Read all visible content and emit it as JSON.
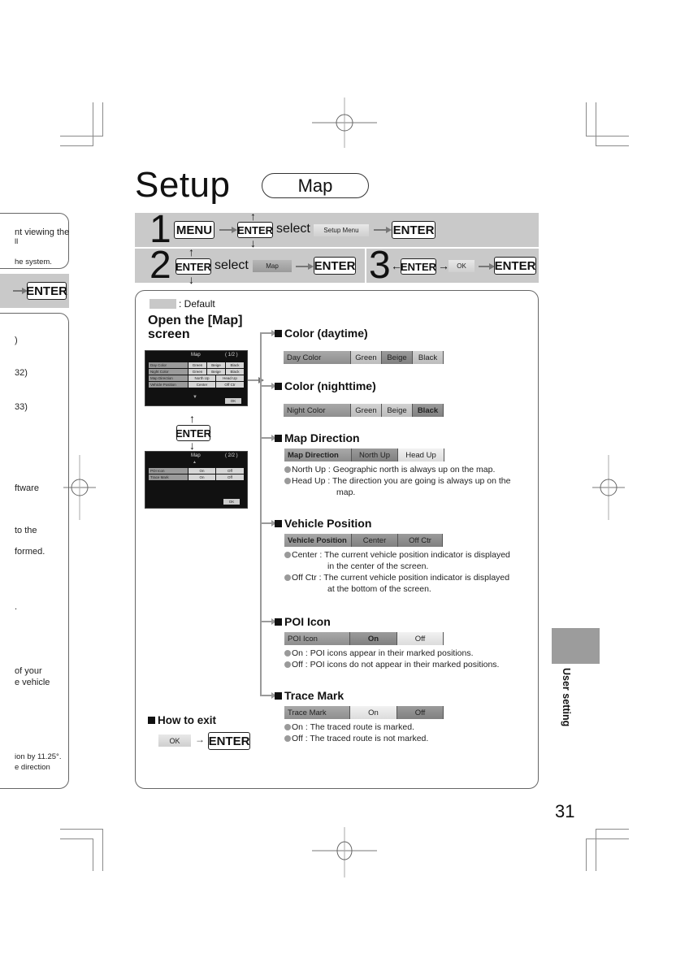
{
  "page": {
    "title": "Setup",
    "section_pill": "Map",
    "page_number": "31",
    "side_tab_label": "User setting"
  },
  "steps": {
    "step1": {
      "number": "1",
      "menu_key": "MENU",
      "enter_key": "ENTER",
      "select_word": "select",
      "menu_chip": "Setup Menu",
      "confirm_key": "ENTER"
    },
    "step2": {
      "number": "2",
      "enter_key": "ENTER",
      "select_word": "select",
      "menu_chip": "Map",
      "confirm_key": "ENTER"
    },
    "step3": {
      "number": "3",
      "enter_key": "ENTER",
      "ok_chip": "OK",
      "confirm_key": "ENTER"
    }
  },
  "legend": {
    "text": ": Default"
  },
  "open_screen": {
    "title_line1": "Open the [Map]",
    "title_line2": "screen",
    "enter_key": "ENTER",
    "screen1": {
      "title": "Map",
      "page": "( 1/2 )",
      "rows": [
        {
          "label": "Day Color",
          "options": [
            "Green",
            "Beige",
            "Black"
          ]
        },
        {
          "label": "Night Color",
          "options": [
            "Green",
            "Beige",
            "Black"
          ]
        },
        {
          "label": "Map Direction",
          "options": [
            "North Up",
            "Head Up"
          ]
        },
        {
          "label": "Vehicle Position",
          "options": [
            "Center",
            "Off Ctr"
          ]
        }
      ],
      "ok": "OK"
    },
    "screen2": {
      "title": "Map",
      "page": "( 2/2 )",
      "rows": [
        {
          "label": "POI Icon",
          "options": [
            "On",
            "Off"
          ]
        },
        {
          "label": "Trace Mark",
          "options": [
            "On",
            "Off"
          ]
        }
      ],
      "ok": "OK"
    }
  },
  "sections": [
    {
      "title": "Color (daytime)",
      "bar_label": "Day Color",
      "options": [
        "Green",
        "Beige",
        "Black"
      ],
      "default": "Beige",
      "descriptions": []
    },
    {
      "title": "Color (nighttime)",
      "bar_label": "Night Color",
      "options": [
        "Green",
        "Beige",
        "Black"
      ],
      "default": "Black",
      "descriptions": []
    },
    {
      "title": "Map Direction",
      "bar_label": "Map Direction",
      "options": [
        "North Up",
        "Head Up"
      ],
      "default": "North Up",
      "descriptions": [
        {
          "term": "North Up :",
          "text": "Geographic north is always up on the map."
        },
        {
          "term": "Head Up :",
          "text": "The direction you are going is always up on the",
          "cont": "map."
        }
      ]
    },
    {
      "title": "Vehicle Position",
      "bar_label": "Vehicle Position",
      "options": [
        "Center",
        "Off Ctr"
      ],
      "default": "Center",
      "descriptions": [
        {
          "term": "Center :",
          "text": "The current vehicle position indicator is displayed",
          "cont": "in the center of the screen."
        },
        {
          "term": "Off Ctr :",
          "text": "The current vehicle position indicator is displayed",
          "cont": "at the bottom of the screen."
        }
      ]
    },
    {
      "title": "POI Icon",
      "bar_label": "POI Icon",
      "options": [
        "On",
        "Off"
      ],
      "default": "On",
      "descriptions": [
        {
          "term": "On :",
          "text": "POI icons appear in their marked positions."
        },
        {
          "term": "Off :",
          "text": "POI icons do not appear in their marked positions."
        }
      ]
    },
    {
      "title": "Trace Mark",
      "bar_label": "Trace Mark",
      "options": [
        "On",
        "Off"
      ],
      "default": "Off",
      "descriptions": [
        {
          "term": "On :",
          "text": "The traced route is marked."
        },
        {
          "term": "Off :",
          "text": "The traced route is not marked."
        }
      ]
    }
  ],
  "exit": {
    "title": "How to exit",
    "ok_chip": "OK",
    "arrow": "→",
    "enter_key": "ENTER"
  },
  "left_page": {
    "box1_lines": [
      "nt viewing the",
      "ll",
      "he system."
    ],
    "bar_key": "ENTER",
    "box2_lines": [
      ")",
      "32)",
      "33)",
      "ftware",
      "to the",
      "formed.",
      ".",
      "of your",
      "e vehicle",
      "ion by 11.25°.",
      "e direction"
    ]
  },
  "colors": {
    "step_bar": "#c9c9c9",
    "default_swatch": "#c8c8c8",
    "side_tab": "#9c9c9c",
    "connector": "#9a9a9a"
  }
}
